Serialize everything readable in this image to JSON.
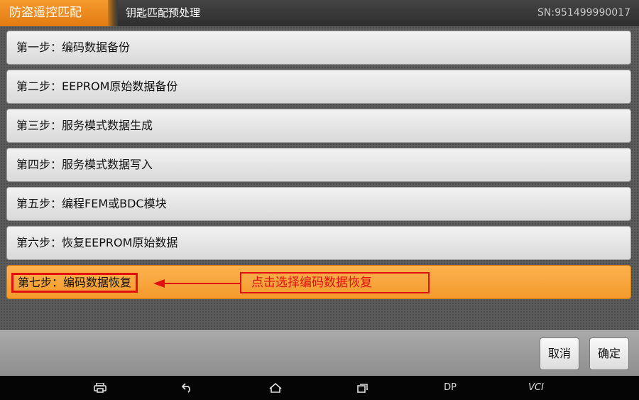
{
  "header": {
    "app_title": "防盗遥控匹配",
    "page_title": "钥匙匹配预处理",
    "serial": "SN:951499990017"
  },
  "steps": [
    {
      "label": "第一步：编码数据备份"
    },
    {
      "label": "第二步：EEPROM原始数据备份"
    },
    {
      "label": "第三步：服务模式数据生成"
    },
    {
      "label": "第四步：服务模式数据写入"
    },
    {
      "label": "第五步：编程FEM或BDC模块"
    },
    {
      "label": "第六步：恢复EEPROM原始数据"
    },
    {
      "label": "第七步：编码数据恢复",
      "selected": true
    }
  ],
  "annotation": {
    "text": "点击选择编码数据恢复",
    "color": "#e01010"
  },
  "footer": {
    "cancel_label": "取消",
    "confirm_label": "确定"
  },
  "navbar": {
    "items": [
      "print-icon",
      "back-icon",
      "home-icon",
      "recents-icon",
      "DP",
      "VCI"
    ]
  },
  "colors": {
    "accent": "#f39a2c",
    "header_bg": "#3a3a3a"
  }
}
